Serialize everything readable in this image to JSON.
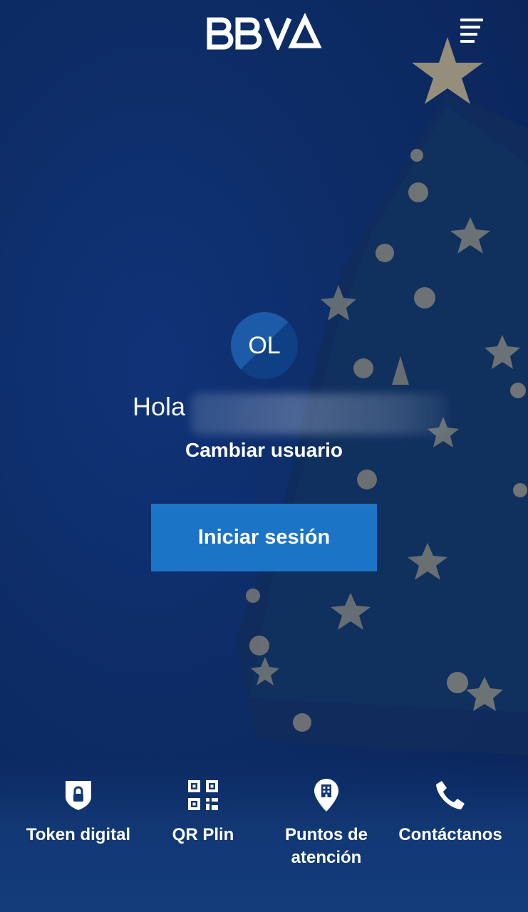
{
  "header": {
    "logo_text": "BBVA",
    "menu_icon": "hamburger-icon"
  },
  "user": {
    "initials": "OL",
    "greeting": "Hola"
  },
  "change_user_label": "Cambiar usuario",
  "login_button_label": "Iniciar sesión",
  "quick_actions": [
    {
      "label": "Token digital",
      "icon": "shield-lock-icon"
    },
    {
      "label": "QR Plin",
      "icon": "qr-code-icon"
    },
    {
      "label": "Puntos de atención",
      "icon": "location-building-icon"
    },
    {
      "label": "Contáctanos",
      "icon": "phone-icon"
    }
  ],
  "colors": {
    "background": "#0d2c66",
    "primary_button": "#1c74c6",
    "avatar": "#1d5ba8"
  }
}
